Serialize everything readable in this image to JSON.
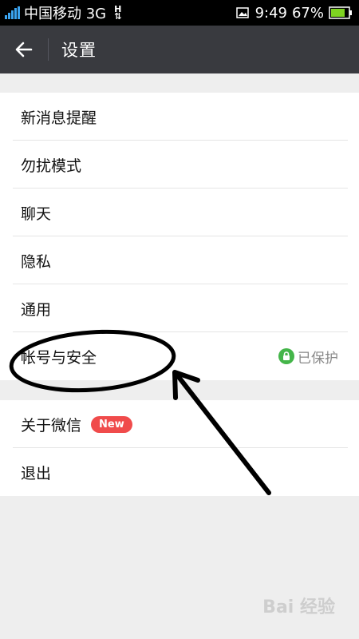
{
  "status_bar": {
    "carrier": "中国移动",
    "network": "3G",
    "data_indicator": "H",
    "time": "9:49",
    "battery": "67%"
  },
  "app_bar": {
    "title": "设置",
    "back_icon": "arrow-left-icon"
  },
  "settings": {
    "group1": [
      {
        "label": "新消息提醒"
      },
      {
        "label": "勿扰模式"
      },
      {
        "label": "聊天"
      },
      {
        "label": "隐私"
      },
      {
        "label": "通用"
      },
      {
        "label": "帐号与安全",
        "status": "已保护",
        "status_icon": "lock-icon"
      }
    ],
    "group2": [
      {
        "label": "关于微信",
        "badge": "New"
      },
      {
        "label": "退出"
      }
    ]
  },
  "watermark": "Bai 经验",
  "colors": {
    "app_bar": "#393a3f",
    "background": "#eeeeee",
    "badge": "#f04b4b",
    "lock_green": "#44b549",
    "battery_green": "#7ed321"
  }
}
